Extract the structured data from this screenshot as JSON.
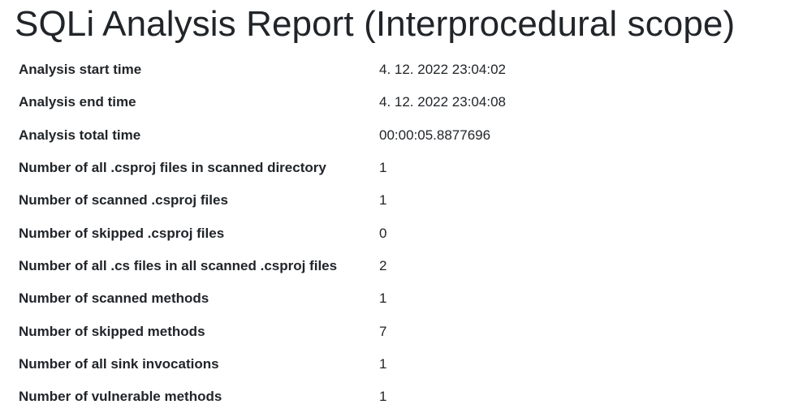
{
  "header": {
    "title": "SQLi Analysis Report (Interprocedural scope)"
  },
  "summary": {
    "rows": [
      {
        "label": "Analysis start time",
        "value": "4. 12. 2022 23:04:02"
      },
      {
        "label": "Analysis end time",
        "value": "4. 12. 2022 23:04:08"
      },
      {
        "label": "Analysis total time",
        "value": "00:00:05.8877696"
      },
      {
        "label": "Number of all .csproj files in scanned directory",
        "value": "1"
      },
      {
        "label": "Number of scanned .csproj files",
        "value": "1"
      },
      {
        "label": "Number of skipped .csproj files",
        "value": "0"
      },
      {
        "label": "Number of all .cs files in all scanned .csproj files",
        "value": "2"
      },
      {
        "label": "Number of scanned methods",
        "value": "1"
      },
      {
        "label": "Number of skipped methods",
        "value": "7"
      },
      {
        "label": "Number of all sink invocations",
        "value": "1"
      },
      {
        "label": "Number of vulnerable methods",
        "value": "1"
      }
    ]
  }
}
